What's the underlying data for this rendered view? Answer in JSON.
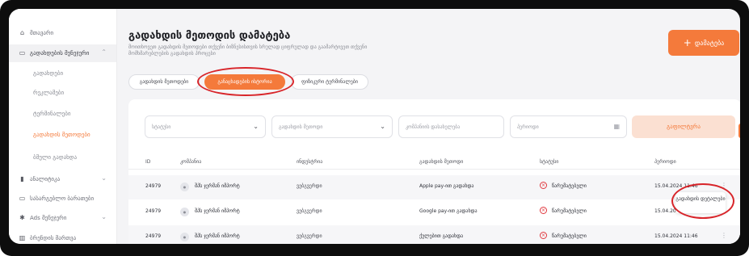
{
  "sidebar": {
    "items": [
      {
        "label": "მთავარი",
        "icon": "home-icon"
      },
      {
        "label": "გადახდების მენეჯერი",
        "icon": "wallet-icon"
      },
      {
        "label": "გადახდები"
      },
      {
        "label": "რეკლამები"
      },
      {
        "label": "ტერმინალები"
      },
      {
        "label": "გადახდის მეთოდები"
      },
      {
        "label": "ბმული გადახდა"
      },
      {
        "label": "ანალიტიკა",
        "icon": "chart-icon"
      },
      {
        "label": "სასარგებლო ბარათები",
        "icon": "card-icon"
      },
      {
        "label": "Ads მენეჯერი",
        "icon": "settings-icon"
      },
      {
        "label": "ბრენდის მართვა",
        "icon": "building-icon"
      }
    ]
  },
  "header": {
    "title": "გადახდის მეთოდის დამატება",
    "subtitle": "მოითხოვეთ გადახდის მეთოდები თქვენი ბიზნესისთვის სრულად ციფრულად და გაამარტივეთ თქვენი მომხმარებლების გადახდის პროცესი",
    "add_label": "დამატება"
  },
  "tabs": [
    {
      "label": "გადახდის მეთოდები"
    },
    {
      "label": "განაცხადების ისტორია"
    },
    {
      "label": "ფიზიკური ტერმინალები"
    }
  ],
  "filters": {
    "status_placeholder": "სტატუსი",
    "method_placeholder": "გადახდის მეთოდი",
    "company_placeholder": "კომპანიის დასახელება",
    "date_placeholder": "პერიოდი",
    "search_label": "გაფილტვრა"
  },
  "table": {
    "columns": [
      "ID",
      "კომპანია",
      "ინდუსტრია",
      "გადახდის მეთოდი",
      "სტატუსი",
      "პერიოდი"
    ],
    "rows": [
      {
        "id": "24979",
        "company": "შპს ჯერმან იმპორტ",
        "industry": "ვებგვერდი",
        "method": "Apple pay-ით გადახდა",
        "status": "წარუმატებელი",
        "date": "15.04.2024 11:46"
      },
      {
        "id": "24979",
        "company": "შპს ჯერმან იმპორტ",
        "industry": "ვებგვერდი",
        "method": "Google pay-ით გადახდა",
        "status": "წარუმატებელი",
        "date": "15.04.2024 11:46"
      },
      {
        "id": "24979",
        "company": "შპს ჯერმან იმპორტ",
        "industry": "ვებგვერდი",
        "method": "ქულებით გადახდა",
        "status": "წარუმატებელი",
        "date": "15.04.2024 11:46"
      }
    ]
  },
  "tooltip": {
    "text": "გადახდის დეტალები"
  },
  "colors": {
    "accent": "#f47a3b",
    "error": "#e0373d",
    "annotation": "#d8252a"
  }
}
